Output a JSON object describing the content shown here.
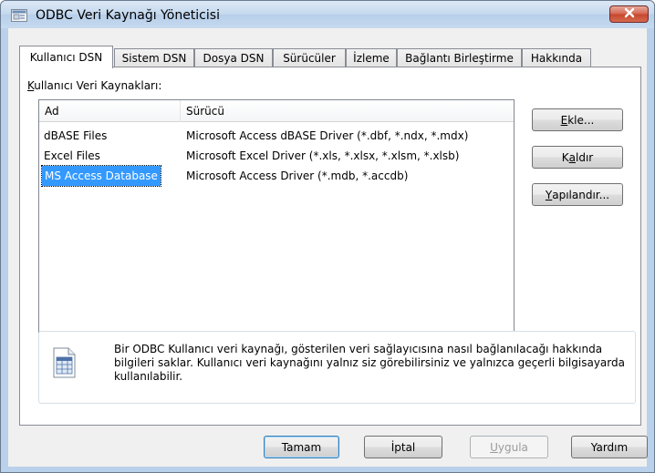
{
  "window": {
    "title": "ODBC Veri Kaynağı Yöneticisi"
  },
  "tabs": [
    {
      "label": "Kullanıcı DSN",
      "active": true
    },
    {
      "label": "Sistem DSN",
      "active": false
    },
    {
      "label": "Dosya DSN",
      "active": false
    },
    {
      "label": "Sürücüler",
      "active": false
    },
    {
      "label": "İzleme",
      "active": false
    },
    {
      "label": "Bağlantı Birleştirme",
      "active": false
    },
    {
      "label": "Hakkında",
      "active": false
    }
  ],
  "user_dsn": {
    "section_label_first": "K",
    "section_label_rest": "ullanıcı Veri Kaynakları:",
    "columns": [
      "Ad",
      "Sürücü"
    ],
    "rows": [
      {
        "name": "dBASE Files",
        "driver": "Microsoft Access dBASE Driver (*.dbf, *.ndx, *.mdx)",
        "selected": false
      },
      {
        "name": "Excel Files",
        "driver": "Microsoft Excel Driver (*.xls, *.xlsx, *.xlsm, *.xlsb)",
        "selected": false
      },
      {
        "name": "MS Access Database",
        "driver": "Microsoft Access Driver (*.mdb, *.accdb)",
        "selected": true
      }
    ],
    "buttons": {
      "add_first": "E",
      "add_rest": "kle...",
      "remove_pre": "K",
      "remove_u": "a",
      "remove_rest": "ldır",
      "configure_first": "Y",
      "configure_rest": "apılandır..."
    },
    "info_text": "Bir ODBC Kullanıcı veri kaynağı, gösterilen veri sağlayıcısına nasıl bağlanılacağı hakkında bilgileri saklar. Kullanıcı veri kaynağını yalnız siz görebilirsiniz ve yalnızca geçerli bilgisayarda kullanılabilir."
  },
  "footer": {
    "ok": "Tamam",
    "cancel": "İptal",
    "apply_first": "U",
    "apply_rest": "ygula",
    "help": "Yardım"
  },
  "icons": {
    "title": "odbc-datasource-icon",
    "close": "close-icon",
    "info": "database-table-icon"
  },
  "colors": {
    "selection": "#3399ff",
    "close_button": "#c5452d",
    "frame": "#b9d1ea"
  }
}
